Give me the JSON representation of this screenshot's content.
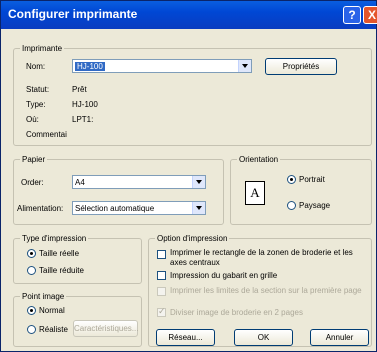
{
  "window": {
    "title": "Configurer imprimante",
    "help_label": "?",
    "close_label": "X"
  },
  "printer": {
    "group_label": "Imprimante",
    "name_label": "Nom:",
    "name_value": "HJ-100",
    "properties_button": "Propriétés",
    "status_label": "Statut:",
    "status_value": "Prêt",
    "type_label": "Type:",
    "type_value": "HJ-100",
    "where_label": "Où:",
    "where_value": "LPT1:",
    "comment_label": "Commentai"
  },
  "paper": {
    "group_label": "Papier",
    "order_label": "Order:",
    "order_value": "A4",
    "feed_label": "Alimentation:",
    "feed_value": "Sélection automatique"
  },
  "orientation": {
    "group_label": "Orientation",
    "icon_letter": "A",
    "portrait_label": "Portrait",
    "landscape_label": "Paysage",
    "selected": "Portrait"
  },
  "print_type": {
    "group_label": "Type d'impression",
    "real_size_label": "Taille réelle",
    "reduced_size_label": "Taille réduite",
    "selected": "Taille réelle"
  },
  "image_point": {
    "group_label": "Point image",
    "normal_label": "Normal",
    "realistic_label": "Réaliste",
    "characteristics_button": "Caractéristiques...",
    "selected": "Normal"
  },
  "print_options": {
    "group_label": "Option d'impression",
    "opt1": "Imprimer le rectangle de la zonen de broderie et les axes centraux",
    "opt2": "Impression du gabarit en grille",
    "opt3": "Imprimer les limites de la section sur la première page",
    "opt4": "Diviser image de broderie en 2 pages"
  },
  "buttons": {
    "network": "Réseau...",
    "ok": "OK",
    "cancel": "Annuler"
  }
}
